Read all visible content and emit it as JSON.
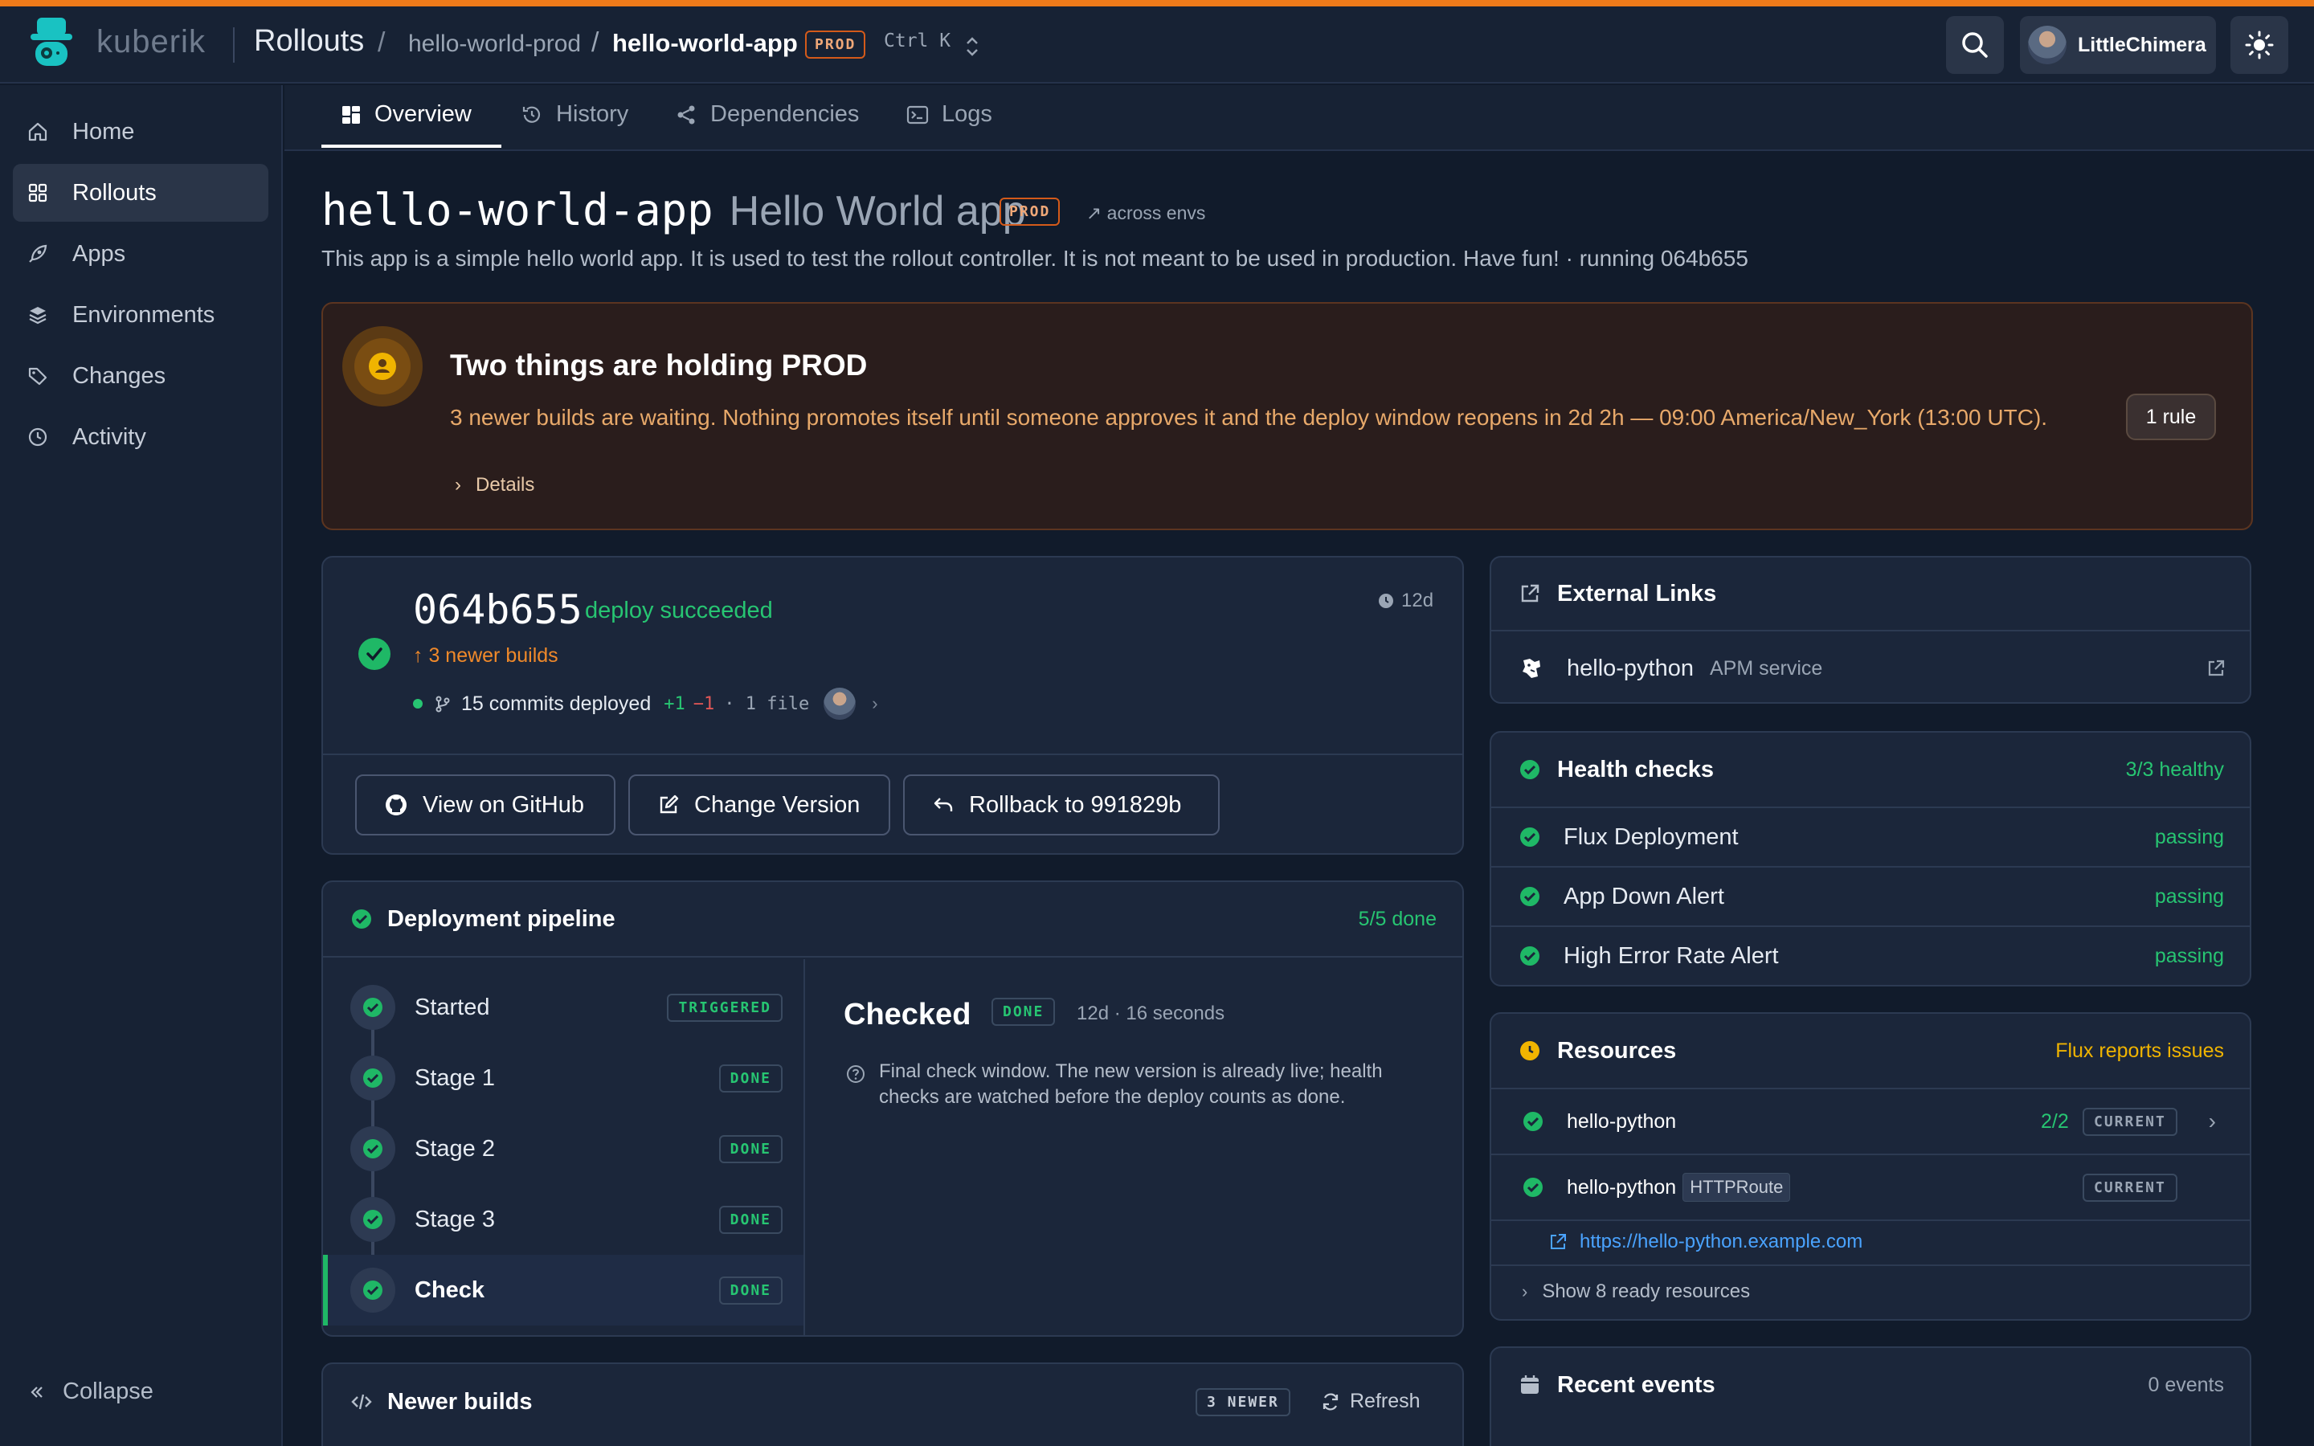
{
  "header": {
    "brand": "kuberik",
    "crumb_section": "Rollouts",
    "crumb_env": "hello-world-prod",
    "crumb_app": "hello-world-app",
    "env_badge": "PROD",
    "shortcut": "Ctrl K",
    "user_name": "LittleChimera"
  },
  "sidebar": {
    "items": [
      {
        "label": "Home",
        "icon": "home-icon"
      },
      {
        "label": "Rollouts",
        "icon": "grid-icon"
      },
      {
        "label": "Apps",
        "icon": "rocket-icon"
      },
      {
        "label": "Environments",
        "icon": "layers-icon"
      },
      {
        "label": "Changes",
        "icon": "tag-icon"
      },
      {
        "label": "Activity",
        "icon": "clock-icon"
      }
    ],
    "active": "Rollouts",
    "collapse_label": "Collapse"
  },
  "tabs": [
    {
      "label": "Overview",
      "icon": "overview-icon"
    },
    {
      "label": "History",
      "icon": "history-icon"
    },
    {
      "label": "Dependencies",
      "icon": "share-icon"
    },
    {
      "label": "Logs",
      "icon": "terminal-icon"
    }
  ],
  "page": {
    "slug": "hello-world-app",
    "name": "Hello World app",
    "env_badge": "PROD",
    "across_envs": "↗ across envs",
    "description": "This app is a simple hello world app. It is used to test the rollout controller. It is not meant to be used in production. Have fun! · running 064b655"
  },
  "banner": {
    "title": "Two things are holding PROD",
    "text": "3 newer builds are waiting. Nothing promotes itself until someone approves it and the deploy window reopens in 2d 2h — 09:00 America/New_York (13:00 UTC).",
    "details_label": "Details",
    "rule_button": "1 rule"
  },
  "deploy": {
    "sha": "064b655",
    "status": "deploy succeeded",
    "age": "12d",
    "newer_builds": "↑ 3 newer builds",
    "commits": "15 commits deployed",
    "added": "+1",
    "removed": "−1",
    "files": "· 1 file",
    "actions": {
      "github": "View on GitHub",
      "change_version": "Change Version",
      "rollback": "Rollback to 991829b"
    }
  },
  "pipeline": {
    "title": "Deployment pipeline",
    "summary": "5/5 done",
    "stages": [
      {
        "name": "Started",
        "tag": "TRIGGERED"
      },
      {
        "name": "Stage 1",
        "tag": "DONE"
      },
      {
        "name": "Stage 2",
        "tag": "DONE"
      },
      {
        "name": "Stage 3",
        "tag": "DONE"
      },
      {
        "name": "Check",
        "tag": "DONE"
      }
    ],
    "detail": {
      "title": "Checked",
      "tag": "DONE",
      "time": "12d · 16 seconds",
      "description": "Final check window. The new version is already live; health checks are watched before the deploy counts as done."
    }
  },
  "newer_builds": {
    "title": "Newer builds",
    "tag": "3 NEWER",
    "refresh": "Refresh"
  },
  "external_links": {
    "title": "External Links",
    "item_name": "hello-python",
    "item_sub": "APM service"
  },
  "health": {
    "title": "Health checks",
    "summary": "3/3 healthy",
    "checks": [
      {
        "name": "Flux Deployment",
        "status": "passing"
      },
      {
        "name": "App Down Alert",
        "status": "passing"
      },
      {
        "name": "High Error Rate Alert",
        "status": "passing"
      }
    ]
  },
  "resources": {
    "title": "Resources",
    "summary": "Flux reports issues",
    "items": [
      {
        "name": "hello-python",
        "count": "2/2",
        "tag": "CURRENT"
      },
      {
        "name": "hello-python",
        "kind": "HTTPRoute",
        "tag": "CURRENT"
      }
    ],
    "link": "https://hello-python.example.com",
    "show_ready": "Show 8 ready resources"
  },
  "events": {
    "title": "Recent events",
    "summary": "0 events"
  },
  "colors": {
    "accent": "#ee7a1a",
    "success": "#1fb866",
    "warning": "#f0b400",
    "link": "#4aa3ff"
  }
}
